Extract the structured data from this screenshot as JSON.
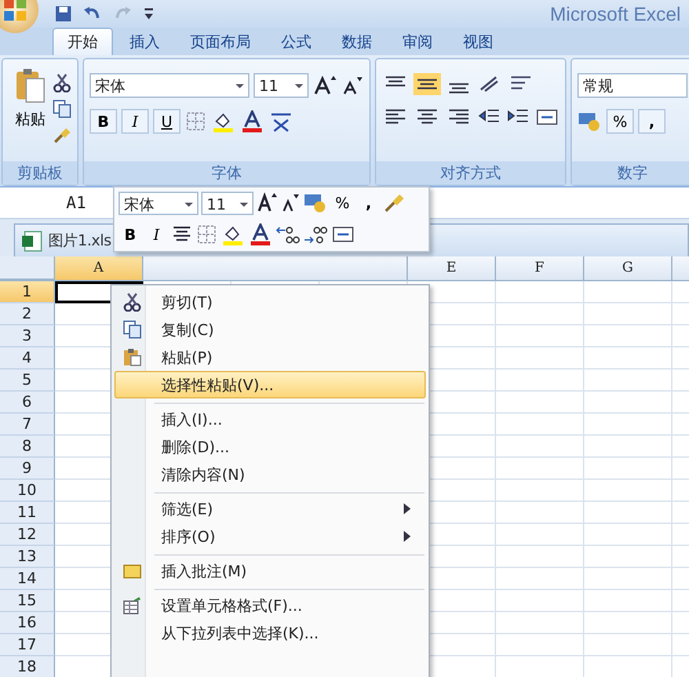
{
  "title": "Microsoft Excel",
  "ribbon_tabs": [
    {
      "label": "开始",
      "selected": true
    },
    {
      "label": "插入",
      "selected": false
    },
    {
      "label": "页面布局",
      "selected": false
    },
    {
      "label": "公式",
      "selected": false
    },
    {
      "label": "数据",
      "selected": false
    },
    {
      "label": "审阅",
      "selected": false
    },
    {
      "label": "视图",
      "selected": false
    }
  ],
  "clipboard_group": {
    "label": "剪贴板",
    "paste": "粘贴"
  },
  "font_group": {
    "label": "字体",
    "font": "宋体",
    "size": "11",
    "bold": "B",
    "italic": "I",
    "underline": "U"
  },
  "alignment_group": {
    "label": "对齐方式"
  },
  "number_group": {
    "label": "数字",
    "format": "常规",
    "percent": "%",
    "comma": ","
  },
  "name_box": "A1",
  "workbook": {
    "title": "图片1.xls",
    "columns": [
      {
        "label": "A",
        "selected": true
      },
      {
        "label": "E",
        "selected": false
      },
      {
        "label": "F",
        "selected": false
      },
      {
        "label": "G",
        "selected": false
      }
    ],
    "rows": [
      {
        "label": "1",
        "selected": true
      },
      {
        "label": "2",
        "selected": false
      },
      {
        "label": "3",
        "selected": false
      },
      {
        "label": "4",
        "selected": false
      },
      {
        "label": "5",
        "selected": false
      },
      {
        "label": "6",
        "selected": false
      },
      {
        "label": "7",
        "selected": false
      },
      {
        "label": "8",
        "selected": false
      },
      {
        "label": "9",
        "selected": false
      },
      {
        "label": "10",
        "selected": false
      },
      {
        "label": "11",
        "selected": false
      },
      {
        "label": "12",
        "selected": false
      },
      {
        "label": "13",
        "selected": false
      },
      {
        "label": "14",
        "selected": false
      },
      {
        "label": "15",
        "selected": false
      },
      {
        "label": "16",
        "selected": false
      },
      {
        "label": "17",
        "selected": false
      },
      {
        "label": "18",
        "selected": false
      }
    ]
  },
  "mini_toolbar": {
    "font": "宋体",
    "size": "11",
    "percent": "%",
    "comma": ",",
    "bold": "B",
    "italic": "I"
  },
  "context_menu": [
    {
      "label": "剪切(T)",
      "kind": "cut",
      "selected": false,
      "submenu": false,
      "separator_before": false
    },
    {
      "label": "复制(C)",
      "kind": "copy",
      "selected": false,
      "submenu": false,
      "separator_before": false
    },
    {
      "label": "粘贴(P)",
      "kind": "paste",
      "selected": false,
      "submenu": false,
      "separator_before": false
    },
    {
      "label": "选择性粘贴(V)...",
      "kind": "plain",
      "selected": true,
      "submenu": false,
      "separator_before": false
    },
    {
      "label": "插入(I)...",
      "kind": "plain",
      "selected": false,
      "submenu": false,
      "separator_before": true
    },
    {
      "label": "删除(D)...",
      "kind": "plain",
      "selected": false,
      "submenu": false,
      "separator_before": false
    },
    {
      "label": "清除内容(N)",
      "kind": "plain",
      "selected": false,
      "submenu": false,
      "separator_before": false
    },
    {
      "label": "筛选(E)",
      "kind": "plain",
      "selected": false,
      "submenu": true,
      "separator_before": true
    },
    {
      "label": "排序(O)",
      "kind": "plain",
      "selected": false,
      "submenu": true,
      "separator_before": false
    },
    {
      "label": "插入批注(M)",
      "kind": "comment",
      "selected": false,
      "submenu": false,
      "separator_before": true
    },
    {
      "label": "设置单元格格式(F)...",
      "kind": "format",
      "selected": false,
      "submenu": false,
      "separator_before": true
    },
    {
      "label": "从下拉列表中选择(K)...",
      "kind": "plain",
      "selected": false,
      "submenu": false,
      "separator_before": false
    }
  ]
}
